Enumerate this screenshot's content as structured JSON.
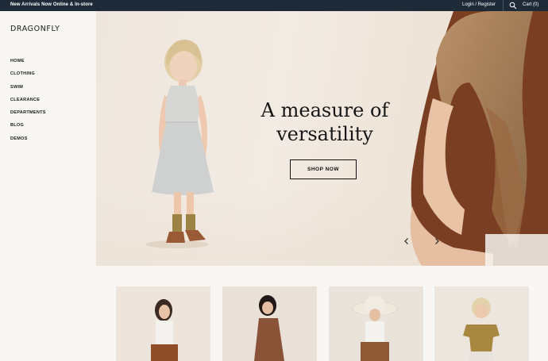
{
  "topbar": {
    "announcement": "New Arrivals Now Online & In-store",
    "login_label": "Login / Register",
    "search_icon": "search-icon",
    "cart_label": "Cart (0)"
  },
  "sidebar": {
    "logo": "DRAGONFLY",
    "nav": [
      {
        "label": "HOME"
      },
      {
        "label": "CLOTHING"
      },
      {
        "label": "SWIM"
      },
      {
        "label": "CLEARANCE"
      },
      {
        "label": "DEPARTMENTS"
      },
      {
        "label": "BLOG"
      },
      {
        "label": "DEMOS"
      }
    ]
  },
  "hero": {
    "title_line1": "A measure of",
    "title_line2": "versatility",
    "cta_label": "SHOP NOW",
    "prev_icon": "chevron-left-icon",
    "next_icon": "chevron-right-icon"
  },
  "products": [
    {
      "image": "product-image-girl-brown-skirt"
    },
    {
      "image": "product-image-girl-rust-dress"
    },
    {
      "image": "product-image-girl-sun-hat"
    },
    {
      "image": "product-image-girl-mustard-top"
    }
  ],
  "colors": {
    "topbar_bg": "#1f2a38",
    "page_bg": "#f7f6f3",
    "hero_bg": "#efe7de",
    "text": "#151515"
  }
}
